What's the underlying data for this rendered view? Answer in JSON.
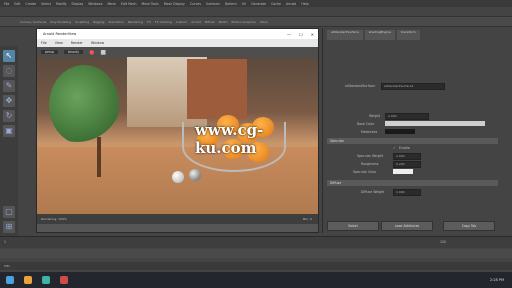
{
  "menubar": {
    "items": [
      "File",
      "Edit",
      "Create",
      "Select",
      "Modify",
      "Display",
      "Windows",
      "Mesh",
      "Edit Mesh",
      "Mesh Tools",
      "Mesh Display",
      "Curves",
      "Surfaces",
      "Deform",
      "UV",
      "Generate",
      "Cache",
      "Arnold",
      "Help"
    ]
  },
  "shelf": {
    "tabs": [
      "Curves / Surfaces",
      "Poly Modeling",
      "Sculpting",
      "Rigging",
      "Animation",
      "Rendering",
      "FX",
      "FX Caching",
      "Custom",
      "Arnold",
      "Bifrost",
      "MASH",
      "Motion Graphics",
      "XGen"
    ]
  },
  "render_view": {
    "title": "Arnold RenderView",
    "window_controls": [
      "—",
      "☐",
      "✕"
    ],
    "menu": [
      "File",
      "View",
      "Render",
      "Window"
    ],
    "toolbar": {
      "camera": "persp",
      "aov": "beauty"
    },
    "status": "Rendering: 100%",
    "status_right": "Min: 0"
  },
  "watermark": "www.cg-ku.com",
  "attribute_editor": {
    "tabs": [
      "aiStandardSurface",
      "shadingEngine",
      "transform"
    ],
    "node_label": "aiStandardSurface:",
    "node_name": "aiStandardSurface1",
    "fields": [
      {
        "label": "Weight",
        "value": "1.000"
      },
      {
        "label": "Base Color",
        "value": ""
      },
      {
        "label": "Metalness",
        "value": ""
      }
    ],
    "specular_section": "Specular",
    "checks": [
      {
        "label": "Enable",
        "value": "✓"
      },
      {
        "label": "Specular Weight",
        "value": "1.000"
      },
      {
        "label": "Roughness",
        "value": "0.200"
      },
      {
        "label": "Specular Color",
        "value": ""
      }
    ],
    "diffuse_section": "Diffuse",
    "diffuse_weight": "Diffuse Weight",
    "diffuse_value": "1.000",
    "buttons": [
      "Select",
      "Load Attributes",
      "Copy Tab"
    ]
  },
  "timeline": {
    "start": "1",
    "end": "120"
  },
  "cmdline": {
    "label": "MEL"
  },
  "taskbar": {
    "clock": "2:28 PM"
  }
}
